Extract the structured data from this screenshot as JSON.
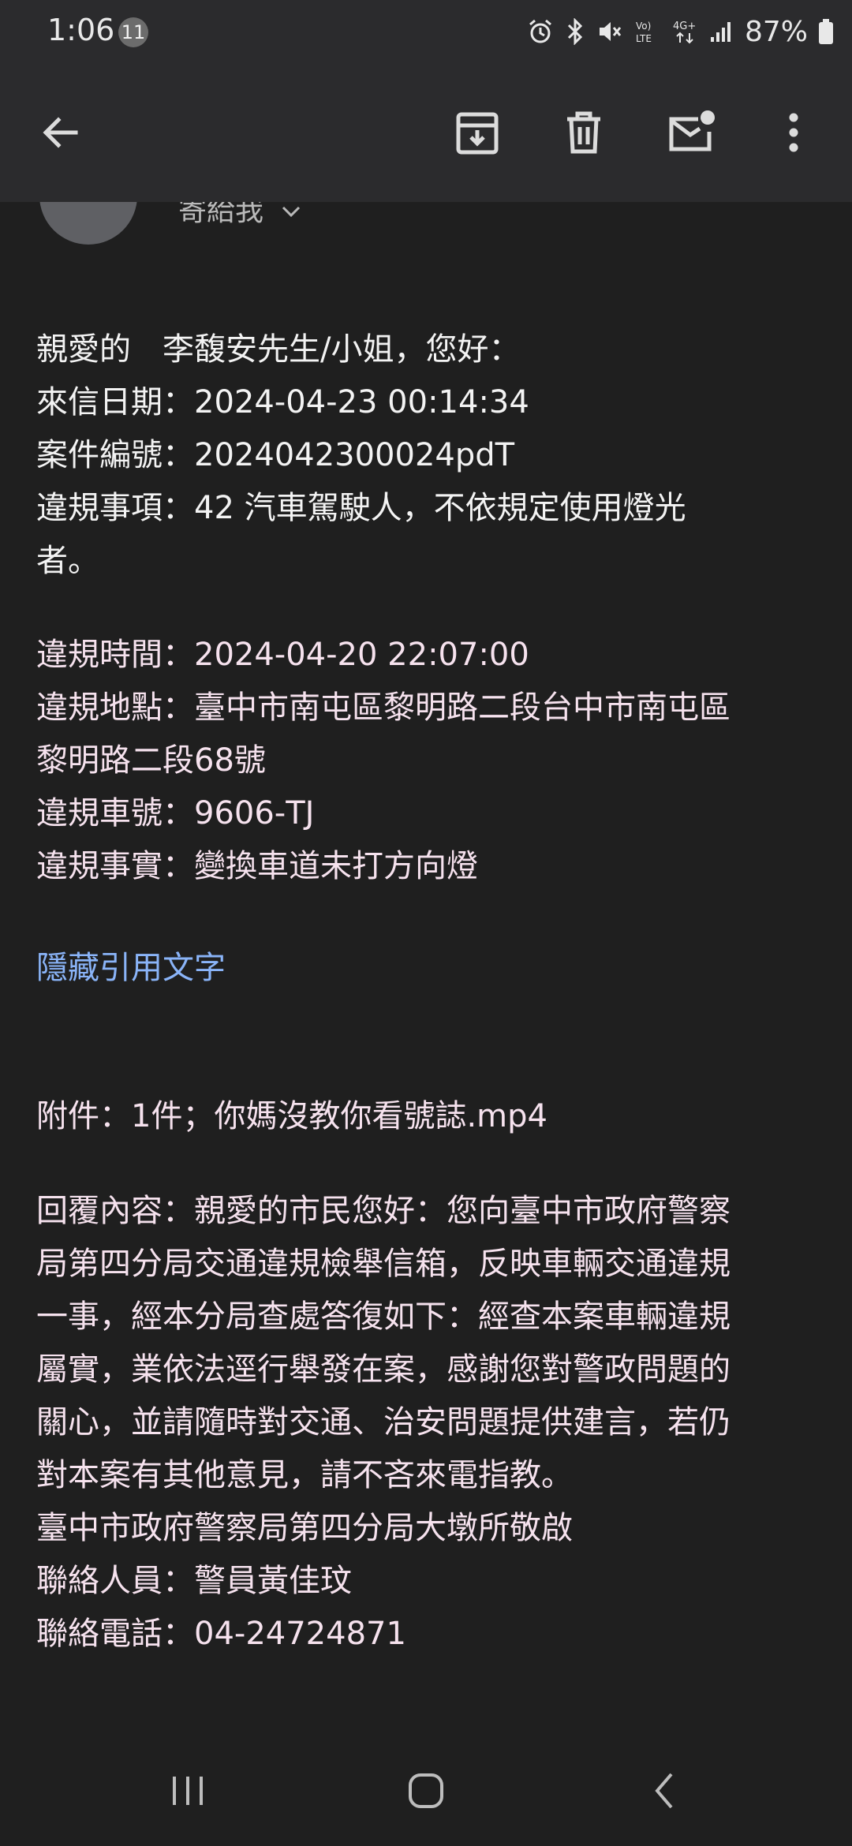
{
  "status_bar": {
    "time": "1:06",
    "notification_count": "11",
    "battery_percent": "87%",
    "network": "4G+",
    "volte": "Vo) LTE"
  },
  "toolbar": {
    "back_icon": "arrow-back-icon",
    "archive_icon": "archive-icon",
    "delete_icon": "trash-icon",
    "mark_unread_icon": "mail-unread-icon",
    "more_icon": "more-vert-icon"
  },
  "header": {
    "recipient": "寄給我"
  },
  "email": {
    "greeting": "親愛的　李馥安先生/小姐，您好：",
    "date_line": "來信日期：2024-04-23 00:14:34",
    "case_line": "案件編號：2024042300024pdT",
    "item_line1": "違規事項：42 汽車駕駛人，不依規定使用燈光",
    "item_line2": "者。",
    "time_line": "違規時間：2024-04-20 22:07:00",
    "place_line1": "違規地點：臺中市南屯區黎明路二段台中市南屯區",
    "place_line2": "黎明路二段68號",
    "plate_line": "違規車號：9606-TJ",
    "fact_line": "違規事實：變換車道未打方向燈",
    "hide_quoted": "隱藏引用文字",
    "attachment_line": "附件：1件；你媽沒教你看號誌.mp4",
    "reply_lines": [
      "回覆內容：親愛的市民您好：您向臺中市政府警察",
      "局第四分局交通違規檢舉信箱，反映車輛交通違規",
      "一事，經本分局查處答復如下：經查本案車輛違規",
      "屬實，業依法逕行舉發在案，感謝您對警政問題的",
      "關心，並請隨時對交通、治安問題提供建言，若仍",
      "對本案有其他意見，請不吝來電指教。",
      "臺中市政府警察局第四分局大墩所敬啟",
      "聯絡人員：警員黃佳玟",
      "聯絡電話：04-24724871"
    ]
  },
  "nav": {
    "recents_icon": "recent-apps-icon",
    "home_icon": "home-icon",
    "back_icon": "nav-back-icon"
  },
  "colors": {
    "background": "#1f1f1f",
    "toolbar": "#2b2b2d",
    "link": "#8ab4f8",
    "reply_text": "#f6e2ee"
  }
}
